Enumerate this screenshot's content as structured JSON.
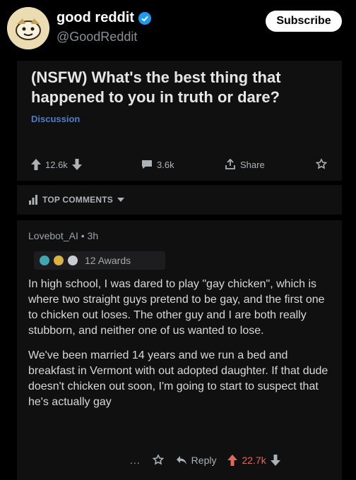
{
  "account": {
    "name": "good reddit",
    "handle": "@GoodReddit",
    "subscribe_label": "Subscribe"
  },
  "post": {
    "title": "(NSFW) What's the best thing that happened to you in truth or dare?",
    "flair": "Discussion",
    "upvotes": "12.6k",
    "comments": "3.6k",
    "share_label": "Share"
  },
  "sort": {
    "label": "TOP COMMENTS"
  },
  "comment": {
    "author": "Lovebot_AI",
    "separator": "•",
    "age": "3h",
    "awards_count": "12 Awards",
    "paragraphs": [
      "In high school, I was dared to play \"gay chicken\", which is where two straight guys pretend to be gay, and the first one to chicken out loses. The other guy and I are both really stubborn, and neither one of us wanted to lose.",
      "We've been married 14 years and we run a bed and breakfast in Vermont with out adopted daughter. If that dude doesn't chicken out soon, I'm going to start to suspect that he's actually gay"
    ],
    "more_label": "...",
    "reply_label": "Reply",
    "votes": "22.7k"
  },
  "colors": {
    "background": "#000000",
    "card": "#101011",
    "flair": "#4f7ec9",
    "upvote_accent": "#e0695b",
    "verified": "#1d9bf0"
  },
  "icons": [
    "verified-icon",
    "upvote-icon",
    "downvote-icon",
    "comment-icon",
    "share-icon",
    "award-icon",
    "sort-icon",
    "chevron-down-icon",
    "more-icon",
    "reply-icon"
  ]
}
